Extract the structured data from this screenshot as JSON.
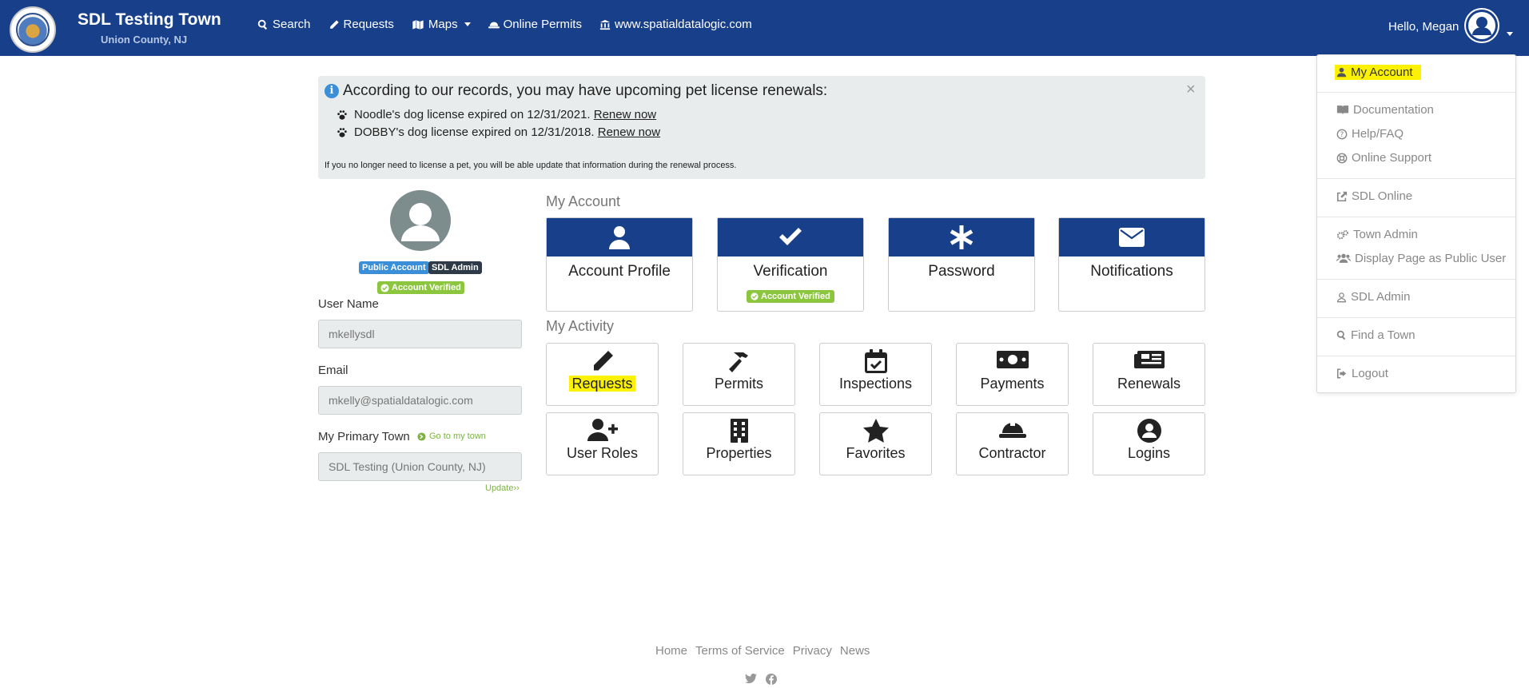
{
  "header": {
    "brand_title": "SDL Testing Town",
    "brand_subtitle": "Union County, NJ",
    "nav": [
      {
        "label": "Search",
        "icon": "search-icon"
      },
      {
        "label": "Requests",
        "icon": "pencil-icon"
      },
      {
        "label": "Maps",
        "icon": "map-icon"
      },
      {
        "label": "Online Permits",
        "icon": "hard-hat-icon"
      },
      {
        "label": "www.spatialdatalogic.com",
        "icon": "bank-icon"
      }
    ],
    "greeting": "Hello, Megan"
  },
  "user_menu": [
    {
      "label": "My Account",
      "icon": "user-icon",
      "highlighted": true
    },
    {
      "label": "Documentation",
      "icon": "book-icon"
    },
    {
      "label": "Help/FAQ",
      "icon": "question-circle-icon"
    },
    {
      "label": "Online Support",
      "icon": "life-ring-icon"
    },
    {
      "label": "SDL Online",
      "icon": "external-link-icon"
    },
    {
      "label": "Town Admin",
      "icon": "cogs-icon"
    },
    {
      "label": "Display Page as Public User",
      "icon": "users-icon"
    },
    {
      "label": "SDL Admin",
      "icon": "user-secret-icon"
    },
    {
      "label": "Find a Town",
      "icon": "search-icon"
    },
    {
      "label": "Logout",
      "icon": "sign-out-icon"
    }
  ],
  "alert": {
    "title": "According to our records, you may have upcoming pet license renewals:",
    "items": [
      {
        "text": "Noodle's dog license expired on 12/31/2021.",
        "link": "Renew now"
      },
      {
        "text": "DOBBY's dog license expired on 12/31/2018.",
        "link": "Renew now"
      }
    ],
    "note": "If you no longer need to license a pet, you will be able update that information during the renewal process.",
    "close": "×"
  },
  "profile": {
    "badges": {
      "public": "Public Account",
      "admin": "SDL Admin",
      "verified": "Account Verified"
    },
    "username_label": "User Name",
    "username_value": "mkellysdl",
    "email_label": "Email",
    "email_value": "mkelly@spatialdatalogic.com",
    "town_label": "My Primary Town",
    "go_to_town": "Go to my town",
    "town_value": "SDL Testing (Union County, NJ)",
    "update_link": "Update››"
  },
  "my_account": {
    "title": "My Account",
    "cards": [
      {
        "label": "Account Profile",
        "icon": "user-icon"
      },
      {
        "label": "Verification",
        "icon": "check-icon",
        "badge": "Account Verified"
      },
      {
        "label": "Password",
        "icon": "asterisk-icon"
      },
      {
        "label": "Notifications",
        "icon": "envelope-icon"
      }
    ]
  },
  "my_activity": {
    "title": "My Activity",
    "cards": [
      {
        "label": "Requests",
        "icon": "pencil-icon",
        "highlighted": true
      },
      {
        "label": "Permits",
        "icon": "hammer-icon"
      },
      {
        "label": "Inspections",
        "icon": "calendar-check-icon"
      },
      {
        "label": "Payments",
        "icon": "money-bill-icon"
      },
      {
        "label": "Renewals",
        "icon": "newspaper-icon"
      },
      {
        "label": "User Roles",
        "icon": "user-plus-icon"
      },
      {
        "label": "Properties",
        "icon": "building-icon"
      },
      {
        "label": "Favorites",
        "icon": "star-icon"
      },
      {
        "label": "Contractor",
        "icon": "hard-hat-icon"
      },
      {
        "label": "Logins",
        "icon": "user-circle-icon"
      }
    ]
  },
  "footer": {
    "links": [
      "Home",
      "Terms of Service",
      "Privacy",
      "News"
    ],
    "social": [
      "twitter-icon",
      "facebook-icon"
    ]
  },
  "colors": {
    "nav_bg": "#173f8a",
    "highlight": "#fbf100",
    "verified_green": "#8cc63f",
    "info_blue": "#3a8fd8"
  }
}
